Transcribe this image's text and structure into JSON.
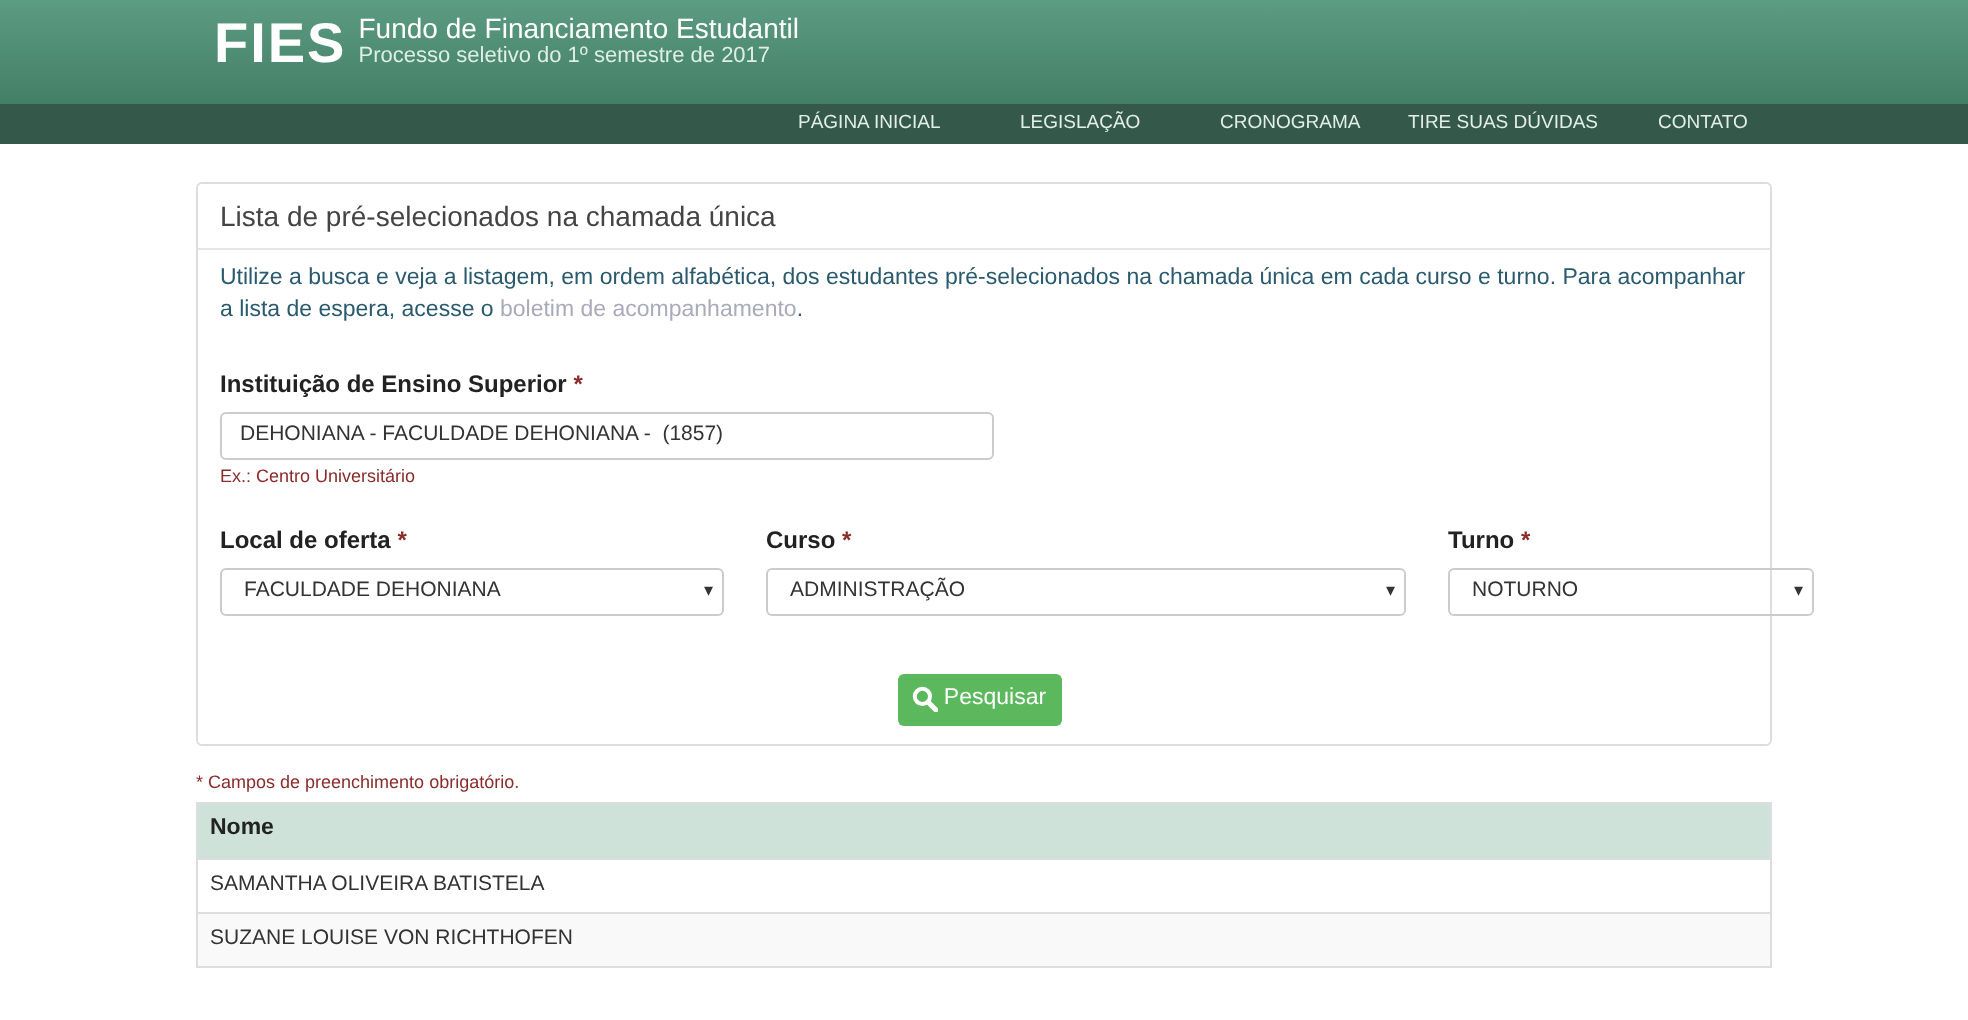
{
  "header": {
    "logo": "FIES",
    "title": "Fundo de Financiamento Estudantil",
    "subtitle": "Processo seletivo do 1º semestre de 2017"
  },
  "nav": [
    {
      "label": "PÁGINA INICIAL"
    },
    {
      "label": "LEGISLAÇÃO"
    },
    {
      "label": "CRONOGRAMA"
    },
    {
      "label": "TIRE SUAS DÚVIDAS"
    },
    {
      "label": "CONTATO"
    }
  ],
  "panel": {
    "title": "Lista de pré-selecionados na chamada única",
    "intro": {
      "before": "Utilize a busca e veja a listagem, em ordem alfabética, dos estudantes pré-selecionados na chamada única em cada curso e turno. Para acompanhar a lista de espera, acesse o ",
      "link": "boletim de acompanhamento",
      "after": "."
    },
    "institution": {
      "label": "Instituição de Ensino Superior",
      "required_mark": "*",
      "value": "DEHONIANA - FACULDADE DEHONIANA -  (1857)",
      "hint": "Ex.: Centro Universitário"
    },
    "selects": [
      {
        "label": "Local de oferta",
        "required_mark": "*",
        "value": "FACULDADE DEHONIANA",
        "arrow": "▾"
      },
      {
        "label": "Curso",
        "required_mark": "*",
        "value": "ADMINISTRAÇÃO",
        "arrow": "▾"
      },
      {
        "label": "Turno",
        "required_mark": "*",
        "value": "NOTURNO",
        "arrow": "▾"
      }
    ],
    "search_button": "Pesquisar"
  },
  "required_note": "* Campos de preenchimento obrigatório.",
  "table": {
    "columns": [
      "Nome"
    ],
    "rows": [
      [
        "SAMANTHA OLIVEIRA BATISTELA"
      ],
      [
        "SUZANE LOUISE VON RICHTHOFEN"
      ]
    ]
  }
}
